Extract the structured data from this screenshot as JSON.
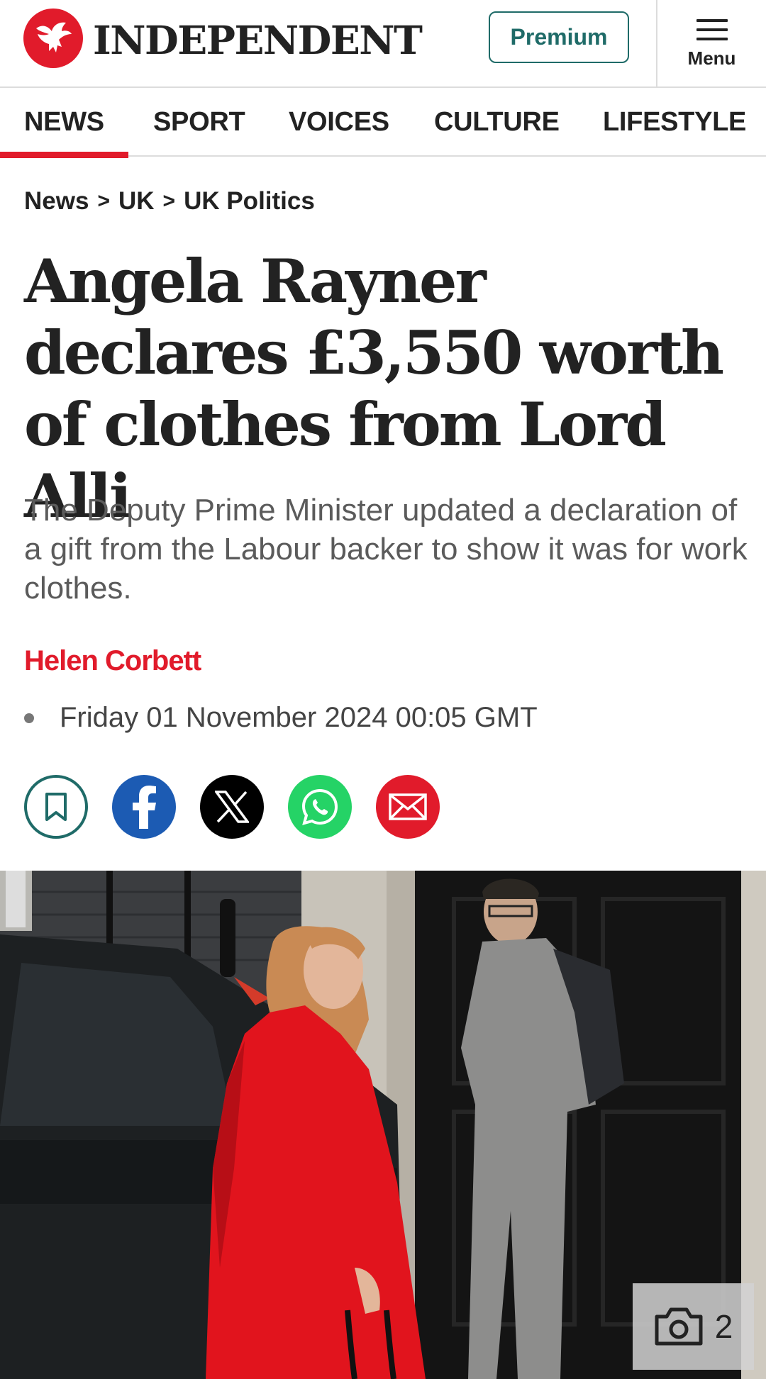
{
  "header": {
    "logo_text": "INDEPENDENT",
    "logo_icon": "eagle-icon",
    "premium_label": "Premium",
    "menu_label": "Menu",
    "menu_icon": "hamburger-icon"
  },
  "nav": {
    "items": [
      {
        "label": "NEWS",
        "active": true
      },
      {
        "label": "SPORT",
        "active": false
      },
      {
        "label": "VOICES",
        "active": false
      },
      {
        "label": "CULTURE",
        "active": false
      },
      {
        "label": "LIFESTYLE",
        "active": false
      }
    ]
  },
  "breadcrumb": {
    "items": [
      "News",
      "UK",
      "UK Politics"
    ],
    "separator": ">"
  },
  "article": {
    "headline": "Angela Rayner declares £3,550 worth of clothes from Lord Alli",
    "standfirst": "The Deputy Prime Minister updated a declaration of a gift from the Labour backer to show it was for work clothes.",
    "author": "Helen Corbett",
    "date": "Friday 01 November 2024 00:05 GMT"
  },
  "share": {
    "icons": [
      "bookmark-icon",
      "facebook-icon",
      "x-icon",
      "whatsapp-icon",
      "email-icon"
    ]
  },
  "photo": {
    "gallery_icon": "camera-icon",
    "gallery_count": "2"
  },
  "colors": {
    "brand_red": "#e11b2b",
    "premium_teal": "#1f6b68",
    "facebook_blue": "#1c5bb3",
    "whatsapp_green": "#25d366"
  }
}
